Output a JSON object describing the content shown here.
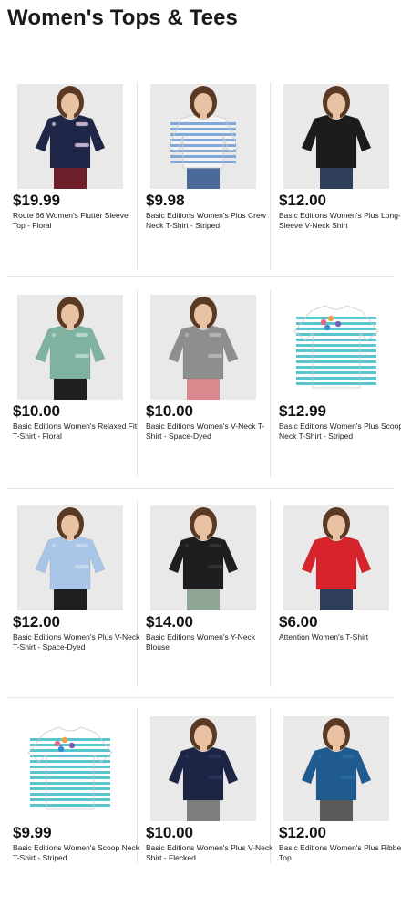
{
  "page": {
    "title": "Women's Tops & Tees"
  },
  "products": [
    {
      "price": "$19.99",
      "name": "Route 66 Women's Flutter Sleeve Top - Floral",
      "image_icon": "navy-floral-flutter-top-image",
      "colors": {
        "top": "#1f2647",
        "pattern": "#c9b9d6",
        "bottom": "#6e1f2a"
      }
    },
    {
      "price": "$9.98",
      "name": "Basic Editions Women's Plus Crew Neck T-Shirt - Striped",
      "image_icon": "striped-crew-tee-image",
      "colors": {
        "top": "#f4f4f4",
        "pattern": "#7aa3d4",
        "bottom": "#4a6a9a"
      }
    },
    {
      "price": "$12.00",
      "name": "Basic Editions Women's Plus Long-Sleeve V-Neck Shirt",
      "image_icon": "black-vneck-longsleeve-image",
      "colors": {
        "top": "#1c1c1c",
        "pattern": "#1c1c1c",
        "bottom": "#2d3d5a"
      }
    },
    {
      "price": "$10.00",
      "name": "Basic Editions Women's Relaxed Fit T-Shirt - Floral",
      "image_icon": "green-floral-tee-image",
      "colors": {
        "top": "#7fb3a0",
        "pattern": "#b9d8cc",
        "bottom": "#1f1f1f"
      }
    },
    {
      "price": "$10.00",
      "name": "Basic Editions Women's V-Neck T-Shirt - Space-Dyed",
      "image_icon": "gray-spacedyed-vneck-image",
      "colors": {
        "top": "#8e8e8e",
        "pattern": "#b5b5b5",
        "bottom": "#d9888e"
      }
    },
    {
      "price": "$12.99",
      "name": "Basic Editions Women's Plus Scoop Neck T-Shirt - Striped",
      "image_icon": "aqua-striped-scoop-tee-image",
      "colors": {
        "top": "#ffffff",
        "pattern": "#4fc1c9",
        "bottom": ""
      }
    },
    {
      "price": "$12.00",
      "name": "Basic Editions Women's Plus V-Neck T-Shirt - Space-Dyed",
      "image_icon": "lightblue-vneck-image",
      "colors": {
        "top": "#a9c6e8",
        "pattern": "#c7daf0",
        "bottom": "#1f1f1f"
      }
    },
    {
      "price": "$14.00",
      "name": "Basic Editions Women's Y-Neck Blouse",
      "image_icon": "black-blouse-image",
      "colors": {
        "top": "#1e1e1e",
        "pattern": "#333333",
        "bottom": "#8fa596"
      }
    },
    {
      "price": "$6.00",
      "name": "Attention Women's T-Shirt",
      "image_icon": "red-scoop-tee-image",
      "colors": {
        "top": "#d6232c",
        "pattern": "#d6232c",
        "bottom": "#2d3d5a"
      }
    },
    {
      "price": "$9.99",
      "name": "Basic Editions Women's Scoop Neck T-Shirt - Striped",
      "image_icon": "aqua-floral-striped-tee-image",
      "colors": {
        "top": "#ffffff",
        "pattern": "#4fc1c9",
        "bottom": ""
      }
    },
    {
      "price": "$10.00",
      "name": "Basic Editions Women's Plus V-Neck Shirt - Flecked",
      "image_icon": "navy-flecked-vneck-image",
      "colors": {
        "top": "#1d2544",
        "pattern": "#2c355a",
        "bottom": "#7d7d7d"
      }
    },
    {
      "price": "$12.00",
      "name": "Basic Editions Women's Plus Ribbed Top",
      "image_icon": "blue-ribbed-top-image",
      "colors": {
        "top": "#1f5b8e",
        "pattern": "#2a6aa0",
        "bottom": "#5a5a5a"
      }
    }
  ]
}
